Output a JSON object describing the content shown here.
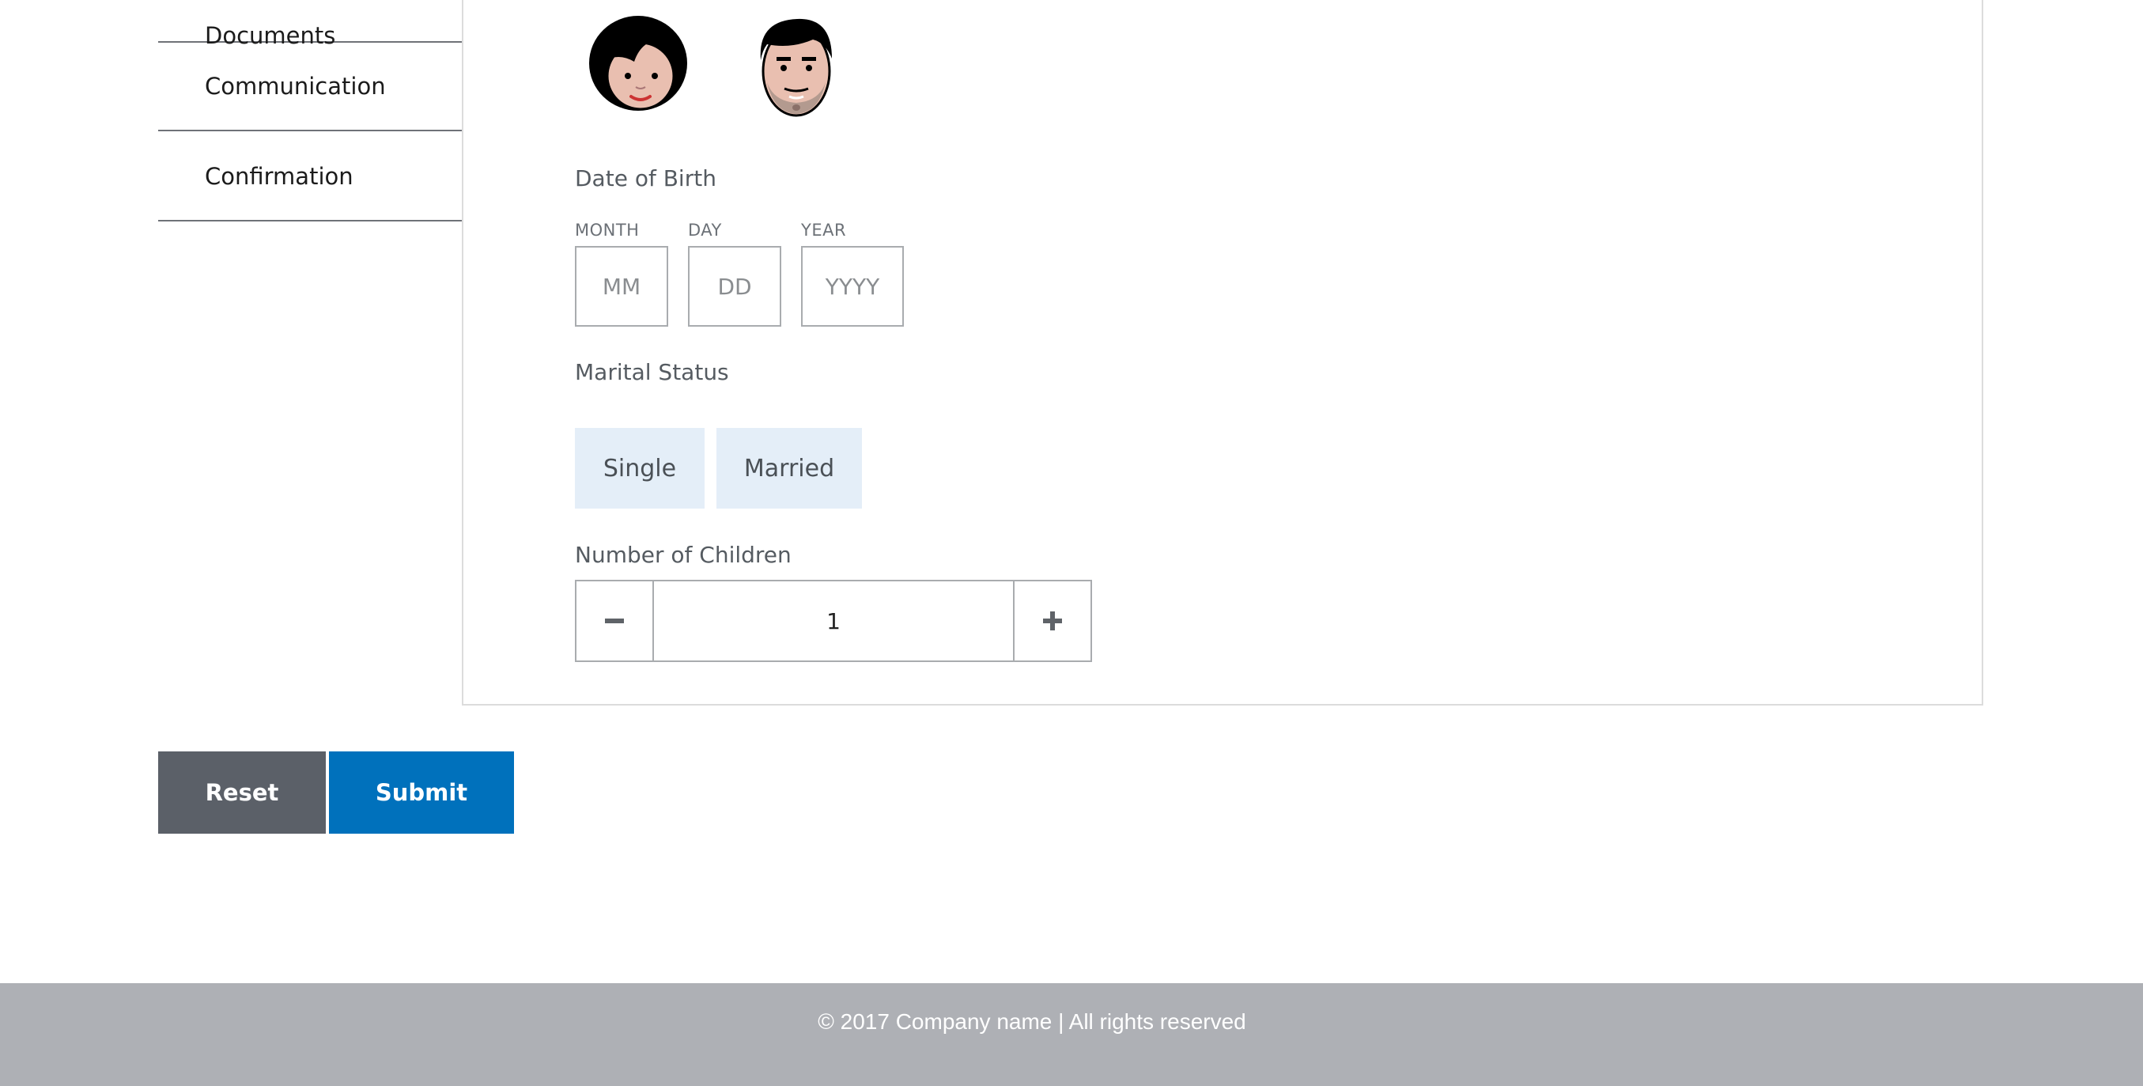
{
  "sidebar": {
    "items": [
      {
        "label": "Documents"
      },
      {
        "label": "Communication"
      },
      {
        "label": "Confirmation"
      }
    ]
  },
  "form": {
    "avatars": [
      {
        "icon": "female-avatar-icon"
      },
      {
        "icon": "male-avatar-icon"
      }
    ],
    "dob": {
      "label": "Date of Birth",
      "month": {
        "label": "MONTH",
        "placeholder": "MM",
        "value": ""
      },
      "day": {
        "label": "DAY",
        "placeholder": "DD",
        "value": ""
      },
      "year": {
        "label": "YEAR",
        "placeholder": "YYYY",
        "value": ""
      }
    },
    "marital": {
      "label": "Marital Status",
      "options": [
        "Single",
        "Married"
      ]
    },
    "children": {
      "label": "Number of Children",
      "value": "1"
    }
  },
  "actions": {
    "reset_label": "Reset",
    "submit_label": "Submit"
  },
  "footer": {
    "text": "© 2017 Company name | All rights reserved"
  },
  "colors": {
    "submit": "#0071bc",
    "reset": "#5b6068",
    "chip_bg": "#e4eef8",
    "footer_bg": "#aeb0b5"
  }
}
